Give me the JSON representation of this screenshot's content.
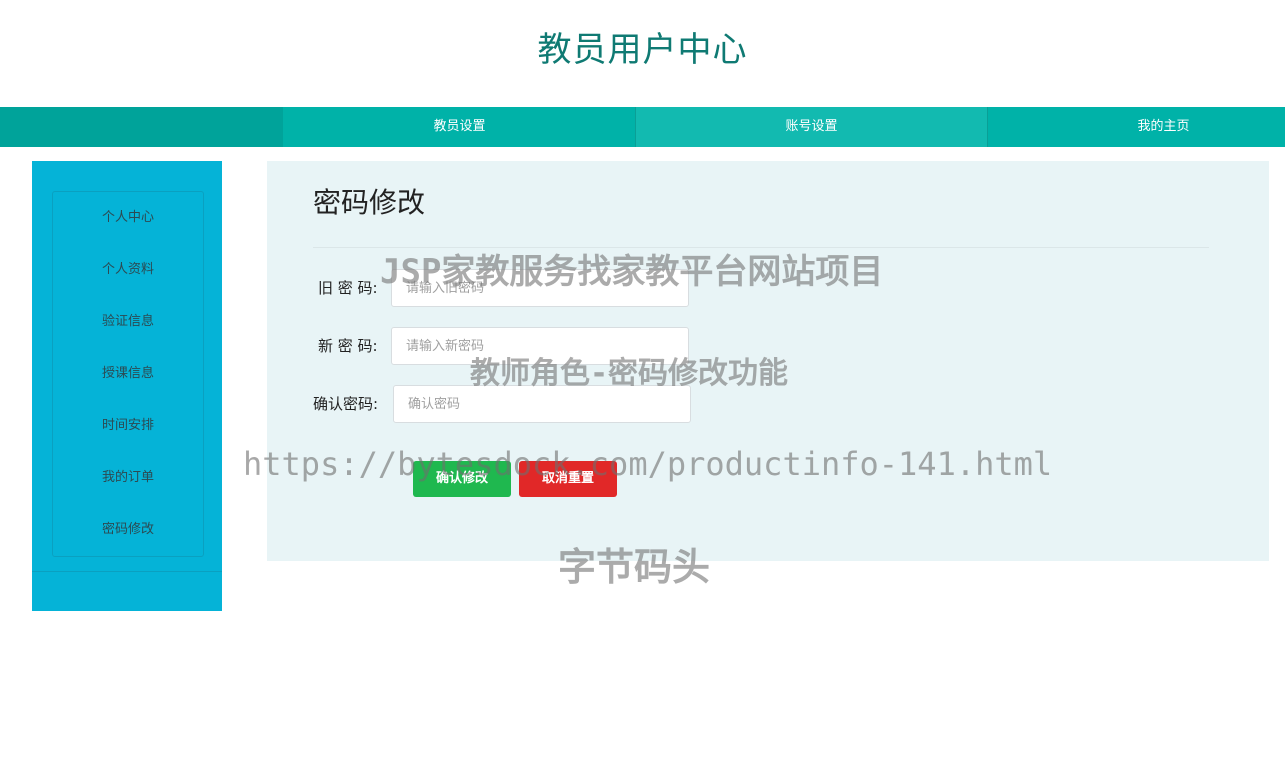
{
  "header": {
    "title": "教员用户中心"
  },
  "top_nav": {
    "items": [
      {
        "label": "教员设置"
      },
      {
        "label": "账号设置"
      },
      {
        "label": "我的主页"
      }
    ]
  },
  "sidebar": {
    "items": [
      {
        "label": "个人中心"
      },
      {
        "label": "个人资料"
      },
      {
        "label": "验证信息"
      },
      {
        "label": "授课信息"
      },
      {
        "label": "时间安排"
      },
      {
        "label": "我的订单"
      },
      {
        "label": "密码修改"
      }
    ]
  },
  "main": {
    "title": "密码修改",
    "fields": {
      "old_password": {
        "label": "旧 密 码:",
        "placeholder": "请输入旧密码"
      },
      "new_password": {
        "label": "新 密 码:",
        "placeholder": "请输入新密码"
      },
      "confirm_password": {
        "label": "确认密码:",
        "placeholder": "确认密码"
      }
    },
    "buttons": {
      "confirm": "确认修改",
      "reset": "取消重置"
    }
  },
  "watermark": {
    "line1": "JSP家教服务找家教平台网站项目",
    "line2": "教师角色-密码修改功能",
    "line3": "https://bytesdock.com/productinfo-141.html",
    "line4": "字节码头"
  },
  "colors": {
    "title": "#0f7a73",
    "nav": "#00b2a8",
    "sidebar": "#05b3d7",
    "panel": "#e8f4f6",
    "confirm": "#1fb84f",
    "reset": "#e12828"
  }
}
